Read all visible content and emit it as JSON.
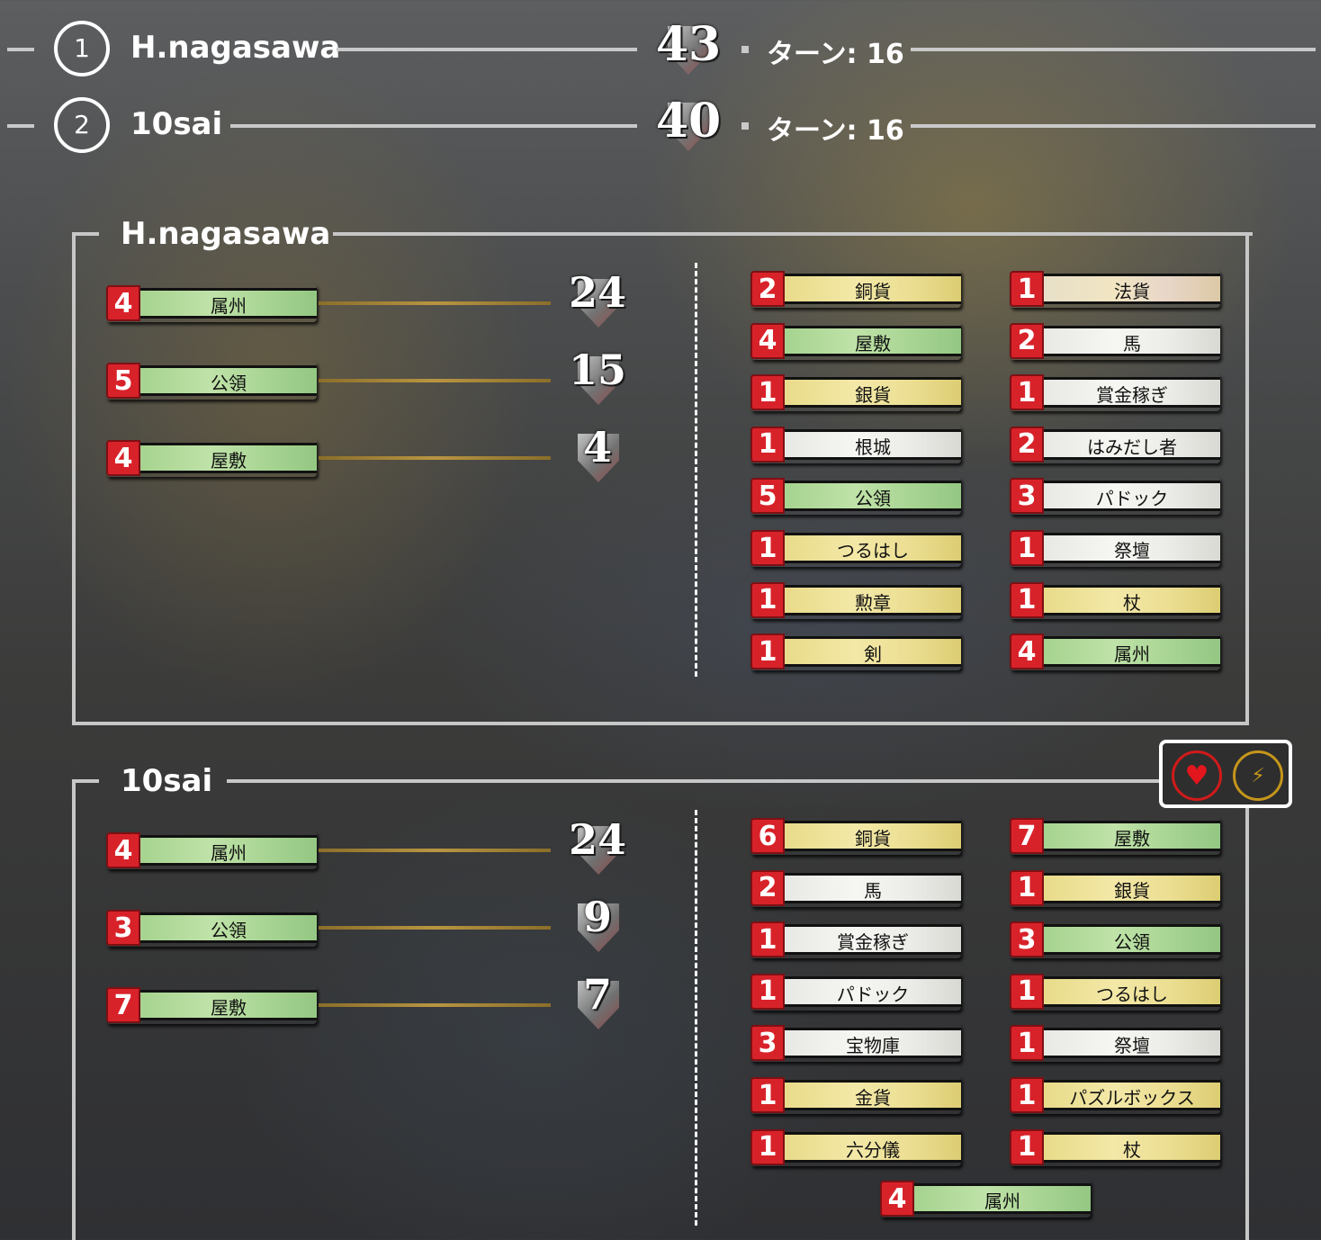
{
  "scoreboard": [
    {
      "rank": "1",
      "name": "H.nagasawa",
      "score": "43",
      "turn_label": "ターン: 16"
    },
    {
      "rank": "2",
      "name": "10sai",
      "score": "40",
      "turn_label": "ターン: 16"
    }
  ],
  "players": [
    {
      "name": "H.nagasawa",
      "summary": [
        {
          "count": "4",
          "label": "属州",
          "color": "green",
          "score": "24"
        },
        {
          "count": "5",
          "label": "公領",
          "color": "green",
          "score": "15"
        },
        {
          "count": "4",
          "label": "屋敷",
          "color": "green",
          "score": "4"
        }
      ],
      "deck_left": [
        {
          "count": "2",
          "label": "銅貨",
          "color": "yellow"
        },
        {
          "count": "4",
          "label": "屋敷",
          "color": "green"
        },
        {
          "count": "1",
          "label": "銀貨",
          "color": "yellow"
        },
        {
          "count": "1",
          "label": "根城",
          "color": "white"
        },
        {
          "count": "5",
          "label": "公領",
          "color": "green"
        },
        {
          "count": "1",
          "label": "つるはし",
          "color": "yellow"
        },
        {
          "count": "1",
          "label": "勲章",
          "color": "yellow"
        },
        {
          "count": "1",
          "label": "剣",
          "color": "yellow"
        }
      ],
      "deck_right": [
        {
          "count": "1",
          "label": "法貨",
          "color": "pink"
        },
        {
          "count": "2",
          "label": "馬",
          "color": "white"
        },
        {
          "count": "1",
          "label": "賞金稼ぎ",
          "color": "white"
        },
        {
          "count": "2",
          "label": "はみだし者",
          "color": "white"
        },
        {
          "count": "3",
          "label": "パドック",
          "color": "white"
        },
        {
          "count": "1",
          "label": "祭壇",
          "color": "white"
        },
        {
          "count": "1",
          "label": "杖",
          "color": "yellow"
        },
        {
          "count": "4",
          "label": "属州",
          "color": "green"
        }
      ]
    },
    {
      "name": "10sai",
      "summary": [
        {
          "count": "4",
          "label": "属州",
          "color": "green",
          "score": "24"
        },
        {
          "count": "3",
          "label": "公領",
          "color": "green",
          "score": "9"
        },
        {
          "count": "7",
          "label": "屋敷",
          "color": "green",
          "score": "7"
        }
      ],
      "deck_left": [
        {
          "count": "6",
          "label": "銅貨",
          "color": "yellow"
        },
        {
          "count": "2",
          "label": "馬",
          "color": "white"
        },
        {
          "count": "1",
          "label": "賞金稼ぎ",
          "color": "white"
        },
        {
          "count": "1",
          "label": "パドック",
          "color": "white"
        },
        {
          "count": "3",
          "label": "宝物庫",
          "color": "white"
        },
        {
          "count": "1",
          "label": "金貨",
          "color": "yellow"
        },
        {
          "count": "1",
          "label": "六分儀",
          "color": "yellow"
        }
      ],
      "deck_right": [
        {
          "count": "7",
          "label": "屋敷",
          "color": "green"
        },
        {
          "count": "1",
          "label": "銀貨",
          "color": "yellow"
        },
        {
          "count": "3",
          "label": "公領",
          "color": "green"
        },
        {
          "count": "1",
          "label": "つるはし",
          "color": "yellow"
        },
        {
          "count": "1",
          "label": "祭壇",
          "color": "white"
        },
        {
          "count": "1",
          "label": "パズルボックス",
          "color": "yellow"
        },
        {
          "count": "1",
          "label": "杖",
          "color": "yellow"
        }
      ],
      "deck_bottom": [
        {
          "count": "4",
          "label": "属州",
          "color": "green"
        }
      ]
    }
  ],
  "reactions": {
    "heart_icon": "heart-icon",
    "bolt_icon": "lightning-icon"
  }
}
